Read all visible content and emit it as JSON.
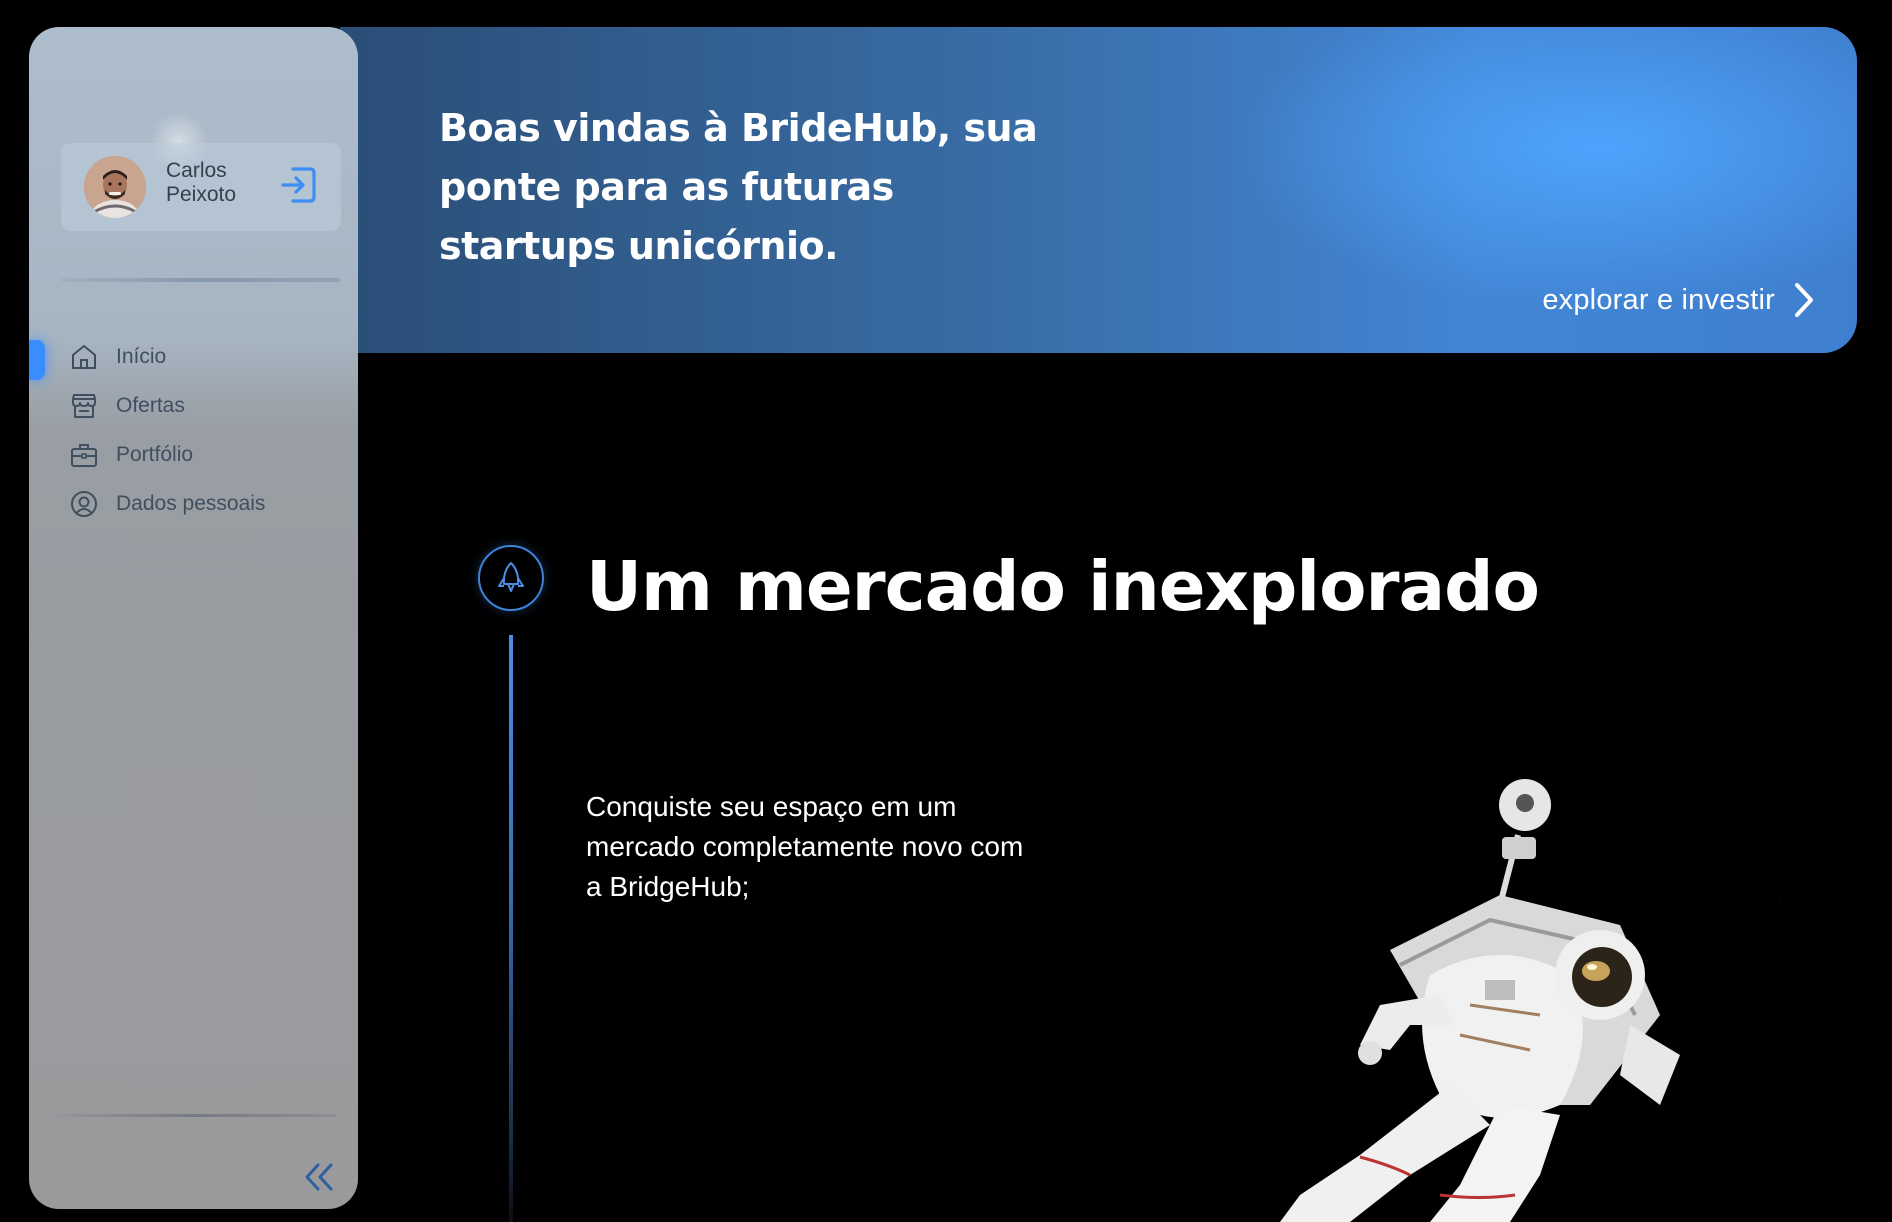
{
  "hero": {
    "title": "Boas vindas à BrideHub, sua ponte para as futuras startups unicórnio.",
    "cta_label": "explorar e investir",
    "cta_icon": "chevron-right-icon"
  },
  "sidebar": {
    "user": {
      "name": "Carlos Peixoto",
      "avatar_icon": "avatar",
      "logout_icon": "logout-icon"
    },
    "nav_items": [
      {
        "label": "Início",
        "icon": "home-icon",
        "active": true
      },
      {
        "label": "Ofertas",
        "icon": "store-icon",
        "active": false
      },
      {
        "label": "Portfólio",
        "icon": "briefcase-icon",
        "active": false
      },
      {
        "label": "Dados pessoais",
        "icon": "user-circle-icon",
        "active": false
      }
    ],
    "collapse_icon": "double-chevron-left-icon"
  },
  "section": {
    "icon": "rocket-icon",
    "title": "Um mercado inexplorado",
    "text": "Conquiste seu espaço em um mercado completamente novo com a BridgeHub;"
  },
  "colors": {
    "accent": "#3a8dff",
    "hero_start": "#2a4e76",
    "hero_end": "#4286d6",
    "sidebar_bg": "#a3adb8",
    "background": "#000000"
  }
}
